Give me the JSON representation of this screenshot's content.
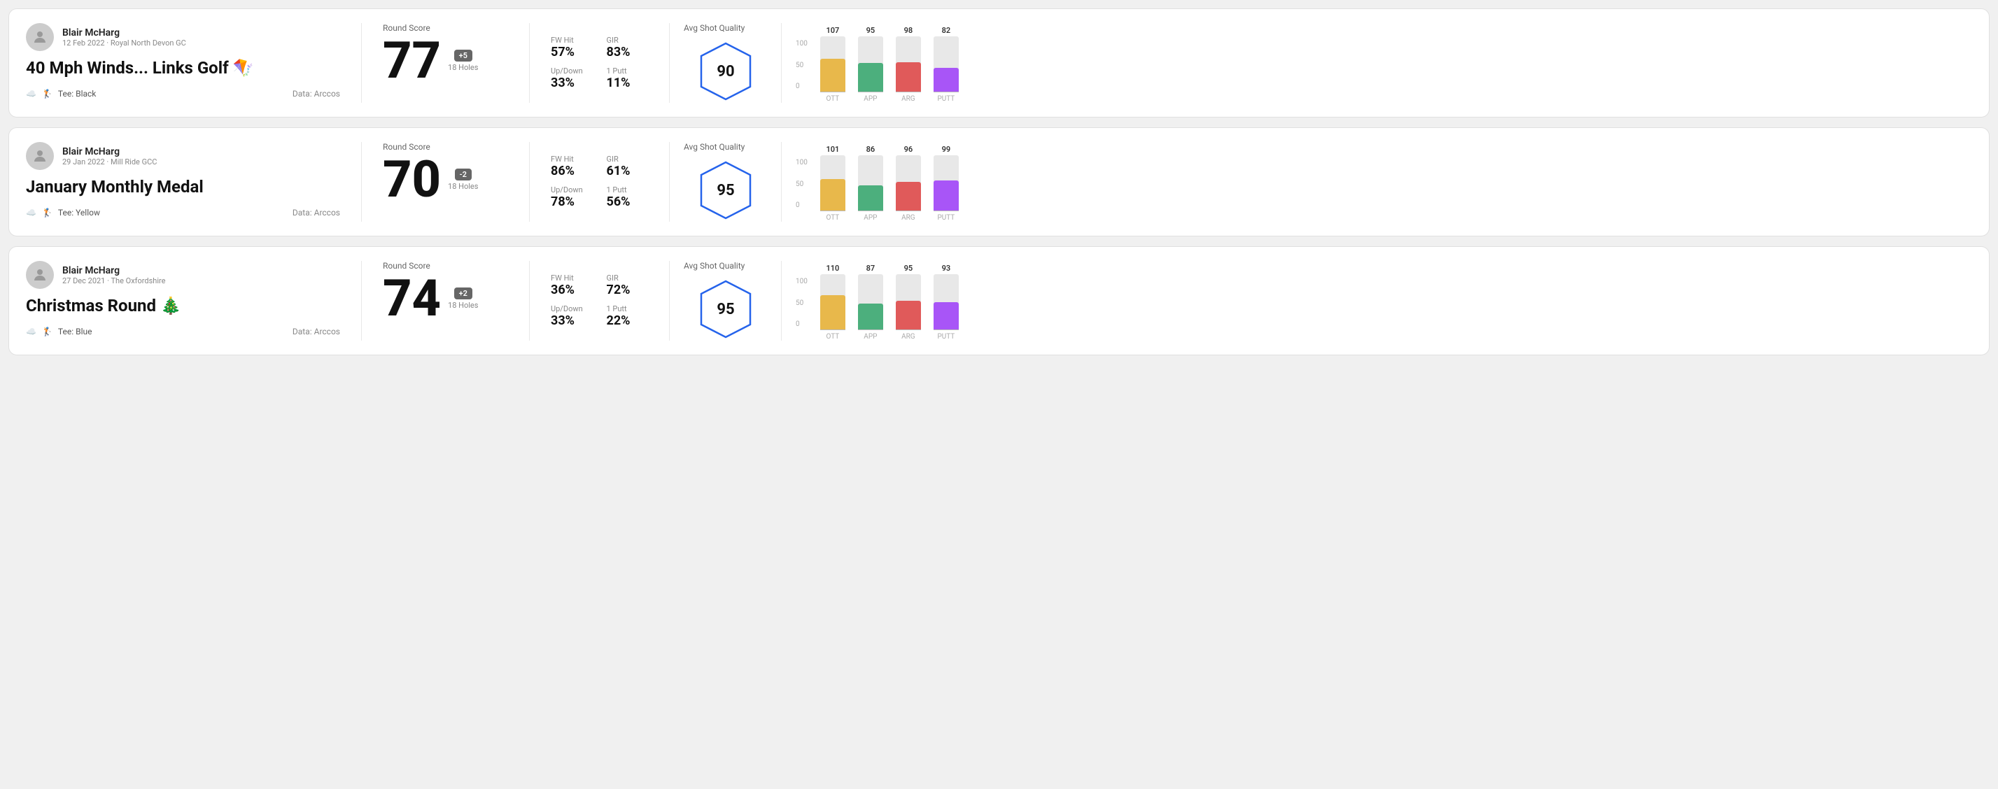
{
  "rounds": [
    {
      "id": "round1",
      "user": {
        "name": "Blair McHarg",
        "date": "12 Feb 2022",
        "course": "Royal North Devon GC"
      },
      "title": "40 Mph Winds... Links Golf 🪁",
      "tee": "Black",
      "data_source": "Arccos",
      "round_score_label": "Round Score",
      "score": "77",
      "badge": "+5",
      "badge_type": "positive",
      "holes": "18 Holes",
      "fw_hit_label": "FW Hit",
      "fw_hit": "57%",
      "gir_label": "GIR",
      "gir": "83%",
      "updown_label": "Up/Down",
      "updown": "33%",
      "oneputt_label": "1 Putt",
      "oneputt": "11%",
      "avg_shot_quality_label": "Avg Shot Quality",
      "quality_score": "90",
      "chart": {
        "bars": [
          {
            "label": "OTT",
            "value": 107,
            "color": "#e8b84b",
            "height_pct": 75
          },
          {
            "label": "APP",
            "value": 95,
            "color": "#4caf7d",
            "height_pct": 65
          },
          {
            "label": "ARG",
            "value": 98,
            "color": "#e05a5a",
            "height_pct": 67
          },
          {
            "label": "PUTT",
            "value": 82,
            "color": "#a855f7",
            "height_pct": 55
          }
        ],
        "y_labels": [
          "100",
          "50",
          "0"
        ]
      }
    },
    {
      "id": "round2",
      "user": {
        "name": "Blair McHarg",
        "date": "29 Jan 2022",
        "course": "Mill Ride GCC"
      },
      "title": "January Monthly Medal",
      "tee": "Yellow",
      "data_source": "Arccos",
      "round_score_label": "Round Score",
      "score": "70",
      "badge": "-2",
      "badge_type": "negative",
      "holes": "18 Holes",
      "fw_hit_label": "FW Hit",
      "fw_hit": "86%",
      "gir_label": "GIR",
      "gir": "61%",
      "updown_label": "Up/Down",
      "updown": "78%",
      "oneputt_label": "1 Putt",
      "oneputt": "56%",
      "avg_shot_quality_label": "Avg Shot Quality",
      "quality_score": "95",
      "chart": {
        "bars": [
          {
            "label": "OTT",
            "value": 101,
            "color": "#e8b84b",
            "height_pct": 71
          },
          {
            "label": "APP",
            "value": 86,
            "color": "#4caf7d",
            "height_pct": 58
          },
          {
            "label": "ARG",
            "value": 96,
            "color": "#e05a5a",
            "height_pct": 66
          },
          {
            "label": "PUTT",
            "value": 99,
            "color": "#a855f7",
            "height_pct": 69
          }
        ],
        "y_labels": [
          "100",
          "50",
          "0"
        ]
      }
    },
    {
      "id": "round3",
      "user": {
        "name": "Blair McHarg",
        "date": "27 Dec 2021",
        "course": "The Oxfordshire"
      },
      "title": "Christmas Round 🎄",
      "tee": "Blue",
      "data_source": "Arccos",
      "round_score_label": "Round Score",
      "score": "74",
      "badge": "+2",
      "badge_type": "positive",
      "holes": "18 Holes",
      "fw_hit_label": "FW Hit",
      "fw_hit": "36%",
      "gir_label": "GIR",
      "gir": "72%",
      "updown_label": "Up/Down",
      "updown": "33%",
      "oneputt_label": "1 Putt",
      "oneputt": "22%",
      "avg_shot_quality_label": "Avg Shot Quality",
      "quality_score": "95",
      "chart": {
        "bars": [
          {
            "label": "OTT",
            "value": 110,
            "color": "#e8b84b",
            "height_pct": 78
          },
          {
            "label": "APP",
            "value": 87,
            "color": "#4caf7d",
            "height_pct": 59
          },
          {
            "label": "ARG",
            "value": 95,
            "color": "#e05a5a",
            "height_pct": 65
          },
          {
            "label": "PUTT",
            "value": 93,
            "color": "#a855f7",
            "height_pct": 63
          }
        ],
        "y_labels": [
          "100",
          "50",
          "0"
        ]
      }
    }
  ]
}
